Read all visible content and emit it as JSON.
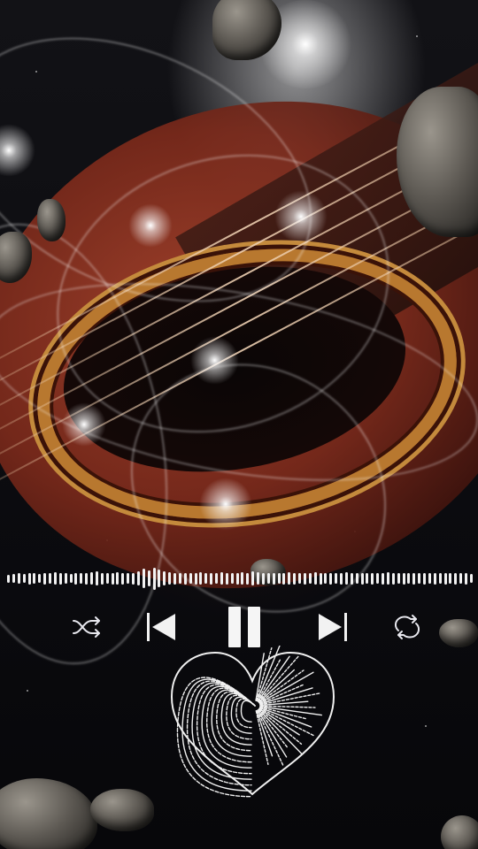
{
  "player": {
    "state": "playing",
    "controls": [
      {
        "name": "shuffle-button",
        "icon": "shuffle-icon"
      },
      {
        "name": "previous-button",
        "icon": "skip-previous-icon"
      },
      {
        "name": "pause-button",
        "icon": "pause-icon"
      },
      {
        "name": "next-button",
        "icon": "skip-next-icon"
      },
      {
        "name": "repeat-button",
        "icon": "repeat-icon"
      }
    ],
    "visualizer_levels": [
      0.35,
      0.4,
      0.45,
      0.4,
      0.5,
      0.45,
      0.4,
      0.5,
      0.45,
      0.55,
      0.5,
      0.45,
      0.4,
      0.5,
      0.45,
      0.5,
      0.55,
      0.6,
      0.5,
      0.45,
      0.5,
      0.55,
      0.5,
      0.45,
      0.5,
      0.6,
      0.85,
      0.7,
      0.95,
      0.75,
      0.6,
      0.55,
      0.5,
      0.45,
      0.5,
      0.45,
      0.5,
      0.55,
      0.45,
      0.5,
      0.45,
      0.55,
      0.5,
      0.45,
      0.5,
      0.55,
      0.5,
      0.6,
      0.55,
      0.5,
      0.45,
      0.5,
      0.45,
      0.5,
      0.55,
      0.5,
      0.45,
      0.5,
      0.45,
      0.55,
      0.5,
      0.45,
      0.5,
      0.45,
      0.5,
      0.55,
      0.5,
      0.45,
      0.5,
      0.45,
      0.5,
      0.45,
      0.5,
      0.55,
      0.5,
      0.45,
      0.5,
      0.45,
      0.5,
      0.45,
      0.5,
      0.45,
      0.5,
      0.45,
      0.5,
      0.45,
      0.5,
      0.45,
      0.5,
      0.4
    ],
    "accent_color": "#f2f2f2",
    "logo": "heart-logo"
  }
}
